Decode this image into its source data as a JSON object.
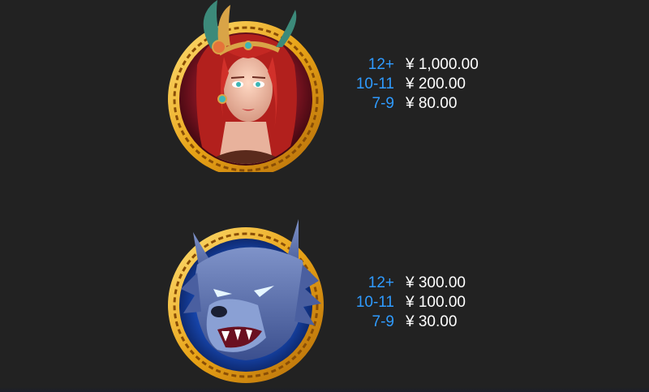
{
  "symbols": [
    {
      "name": "red-haired-warrior-woman",
      "ring_color": "#e8a317",
      "background_color": "#7a1320",
      "pays": [
        {
          "count": "12+",
          "value": "¥ 1,000.00"
        },
        {
          "count": "10-11",
          "value": "¥ 200.00"
        },
        {
          "count": "7-9",
          "value": "¥ 80.00"
        }
      ]
    },
    {
      "name": "blue-wolf",
      "ring_color": "#e8a317",
      "background_color": "#1a4fc0",
      "pays": [
        {
          "count": "12+",
          "value": "¥ 300.00"
        },
        {
          "count": "10-11",
          "value": "¥ 100.00"
        },
        {
          "count": "7-9",
          "value": "¥ 30.00"
        }
      ]
    }
  ],
  "colors": {
    "background": "#222222",
    "count_text": "#2f9bff",
    "value_text": "#ffffff"
  }
}
